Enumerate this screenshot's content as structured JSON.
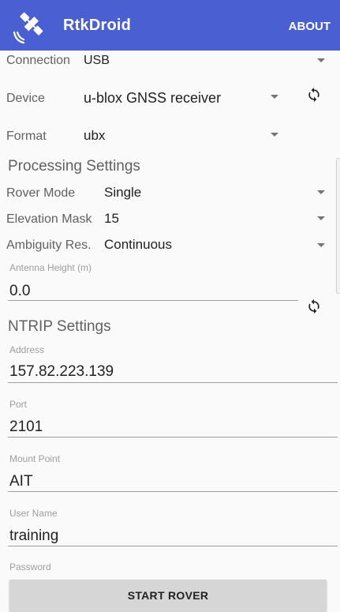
{
  "app": {
    "title": "RtkDroid",
    "about_label": "ABOUT",
    "accent": "#4a5fd1",
    "icon": "satellite-icon"
  },
  "input": {
    "connection": {
      "label": "Connection",
      "value": "USB"
    },
    "device": {
      "label": "Device",
      "value": "u-blox GNSS receiver"
    },
    "format": {
      "label": "Format",
      "value": "ubx"
    }
  },
  "processing": {
    "title": "Processing Settings",
    "rover_mode": {
      "label": "Rover Mode",
      "value": "Single"
    },
    "elevation_mask": {
      "label": "Elevation Mask",
      "value": "15"
    },
    "ambiguity": {
      "label": "Ambiguity Res.",
      "value": "Continuous"
    },
    "antenna_height": {
      "label": "Antenna Height (m)",
      "value": "0.0"
    }
  },
  "ntrip": {
    "title": "NTRIP Settings",
    "address": {
      "label": "Address",
      "value": "157.82.223.139"
    },
    "port": {
      "label": "Port",
      "value": "2101"
    },
    "mount_point": {
      "label": "Mount Point",
      "value": "AIT"
    },
    "user_name": {
      "label": "User Name",
      "value": "training"
    },
    "password": {
      "label": "Password",
      "value": ""
    }
  },
  "actions": {
    "start_label": "START ROVER"
  }
}
